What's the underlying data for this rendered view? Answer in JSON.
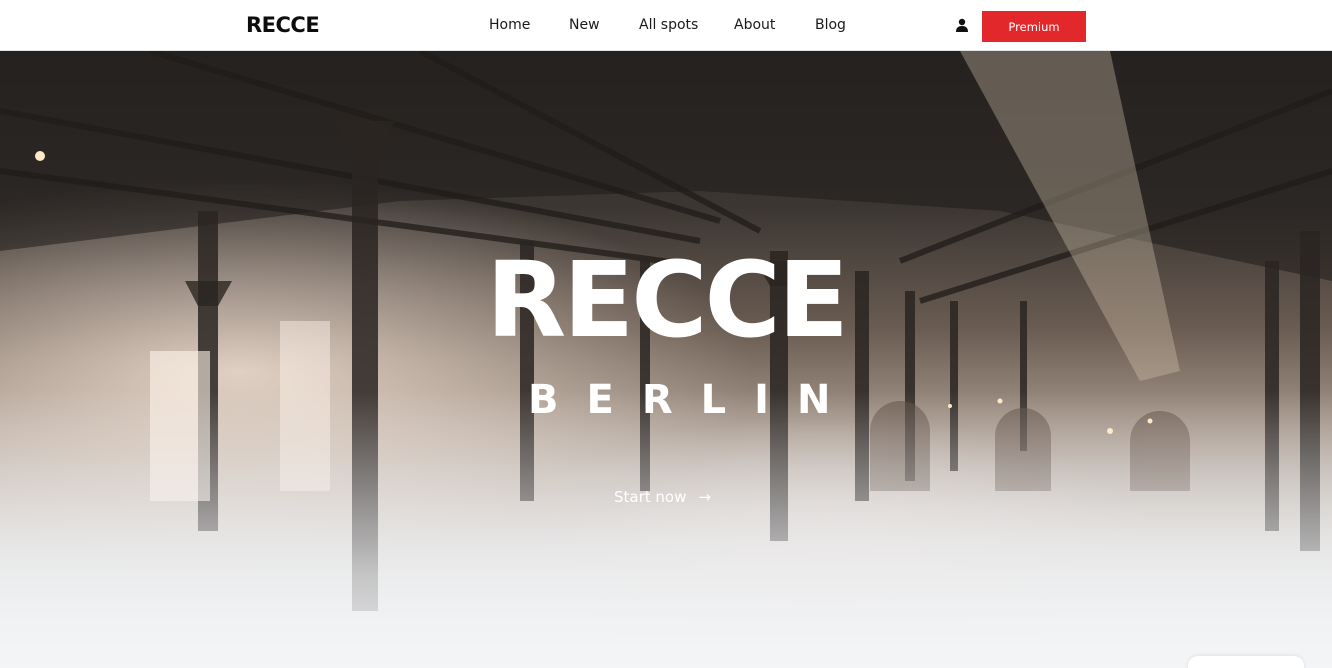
{
  "header": {
    "logo": "RECCE",
    "nav": [
      {
        "label": "Home"
      },
      {
        "label": "New"
      },
      {
        "label": "All spots"
      },
      {
        "label": "About"
      },
      {
        "label": "Blog"
      }
    ],
    "user_icon": "user-icon",
    "premium_label": "Premium",
    "premium_color": "#e3282c"
  },
  "hero": {
    "title": "RECCE",
    "subtitle": "BERLIN",
    "cta_label": "Start now",
    "cta_icon": "arrow-right-icon",
    "cta_arrow": "→"
  }
}
